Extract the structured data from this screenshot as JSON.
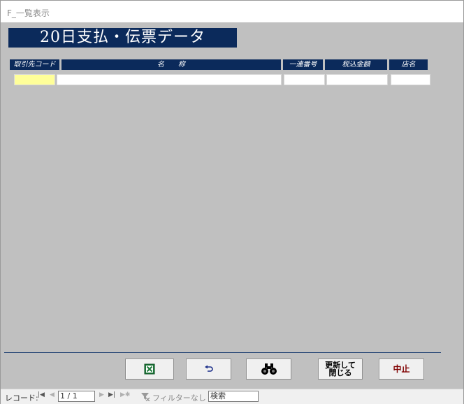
{
  "window": {
    "title": "F_一覧表示"
  },
  "form": {
    "banner": "20日支払・伝票データ",
    "columns": [
      "取引先コード",
      "名　　称",
      "一連番号",
      "税込金額",
      "店名"
    ]
  },
  "buttons": {
    "update_close_label": "更新して\n閉じる",
    "cancel_label": "中止"
  },
  "statusbar": {
    "record_label": "レコード:",
    "record_value": "1 / 1",
    "filter_label": "フィルターなし",
    "search_placeholder": "検索"
  },
  "colors": {
    "header_navy": "#0b2a5b",
    "form_gray": "#c0c0c0",
    "active_field": "#ffff99",
    "cancel_text": "#800000"
  }
}
